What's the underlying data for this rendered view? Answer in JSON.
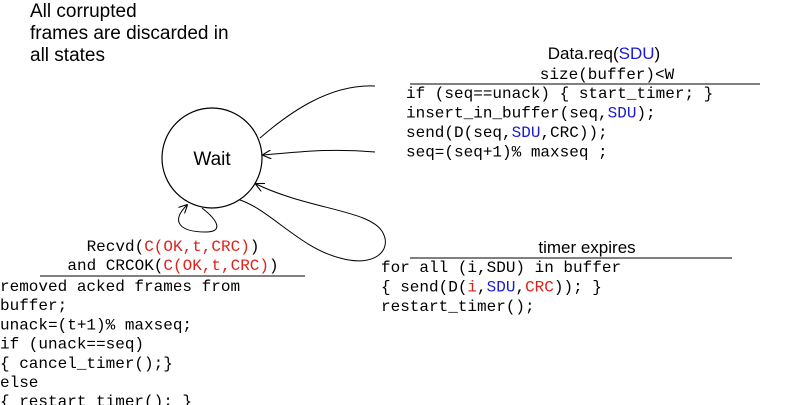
{
  "note": {
    "lines": [
      "All corrupted",
      "frames are discarded in",
      "all states"
    ]
  },
  "state": {
    "label": "Wait"
  },
  "transitions": {
    "data_req": {
      "event": [
        {
          "t": "Data.req(",
          "c": "black"
        },
        {
          "t": "SDU",
          "c": "blue"
        },
        {
          "t": ")",
          "c": "black"
        }
      ],
      "condition": [
        {
          "t": "size(buffer)<W",
          "c": "black"
        }
      ],
      "actions": [
        [
          {
            "t": "if (seq==unack) { start_timer; }",
            "c": "black"
          }
        ],
        [
          {
            "t": "insert_in_buffer(seq,",
            "c": "black"
          },
          {
            "t": "SDU",
            "c": "blue"
          },
          {
            "t": ");",
            "c": "black"
          }
        ],
        [
          {
            "t": "send(D(seq,",
            "c": "black"
          },
          {
            "t": "SDU",
            "c": "blue"
          },
          {
            "t": ",CRC));",
            "c": "black"
          }
        ],
        [
          {
            "t": "seq=(seq+1)% maxseq ;",
            "c": "black"
          }
        ]
      ]
    },
    "timer": {
      "event": [
        {
          "t": "timer expires",
          "c": "black"
        }
      ],
      "actions": [
        [
          {
            "t": "for all (i,SDU) in buffer",
            "c": "black"
          }
        ],
        [
          {
            "t": "{ send(D(",
            "c": "black"
          },
          {
            "t": "i",
            "c": "red"
          },
          {
            "t": ",",
            "c": "black"
          },
          {
            "t": "SDU",
            "c": "blue"
          },
          {
            "t": ",",
            "c": "black"
          },
          {
            "t": "CRC",
            "c": "red"
          },
          {
            "t": ")); }",
            "c": "black"
          }
        ],
        [
          {
            "t": "restart_timer();",
            "c": "black"
          }
        ]
      ]
    },
    "recvd": {
      "event": [
        [
          {
            "t": "Recvd(",
            "c": "black"
          },
          {
            "t": "C(OK,t,CRC)",
            "c": "red"
          },
          {
            "t": ")",
            "c": "black"
          }
        ],
        [
          {
            "t": "and CRCOK(",
            "c": "black"
          },
          {
            "t": "C(OK,t,CRC)",
            "c": "red"
          },
          {
            "t": ")",
            "c": "black"
          }
        ]
      ],
      "actions": [
        [
          {
            "t": "removed acked frames from",
            "c": "black"
          }
        ],
        [
          {
            "t": "buffer;",
            "c": "black"
          }
        ],
        [
          {
            "t": "unack=(t+1)% maxseq;",
            "c": "black"
          }
        ],
        [
          {
            "t": "if (unack==seq)",
            "c": "black"
          }
        ],
        [
          {
            "t": "{ cancel_timer();}",
            "c": "black"
          }
        ],
        [
          {
            "t": "else",
            "c": "black"
          }
        ],
        [
          {
            "t": "{ restart_timer(); }",
            "c": "black"
          }
        ]
      ]
    }
  },
  "colors": {
    "blue": "#1a1ad6",
    "red": "#e0201a",
    "black": "#000000"
  }
}
